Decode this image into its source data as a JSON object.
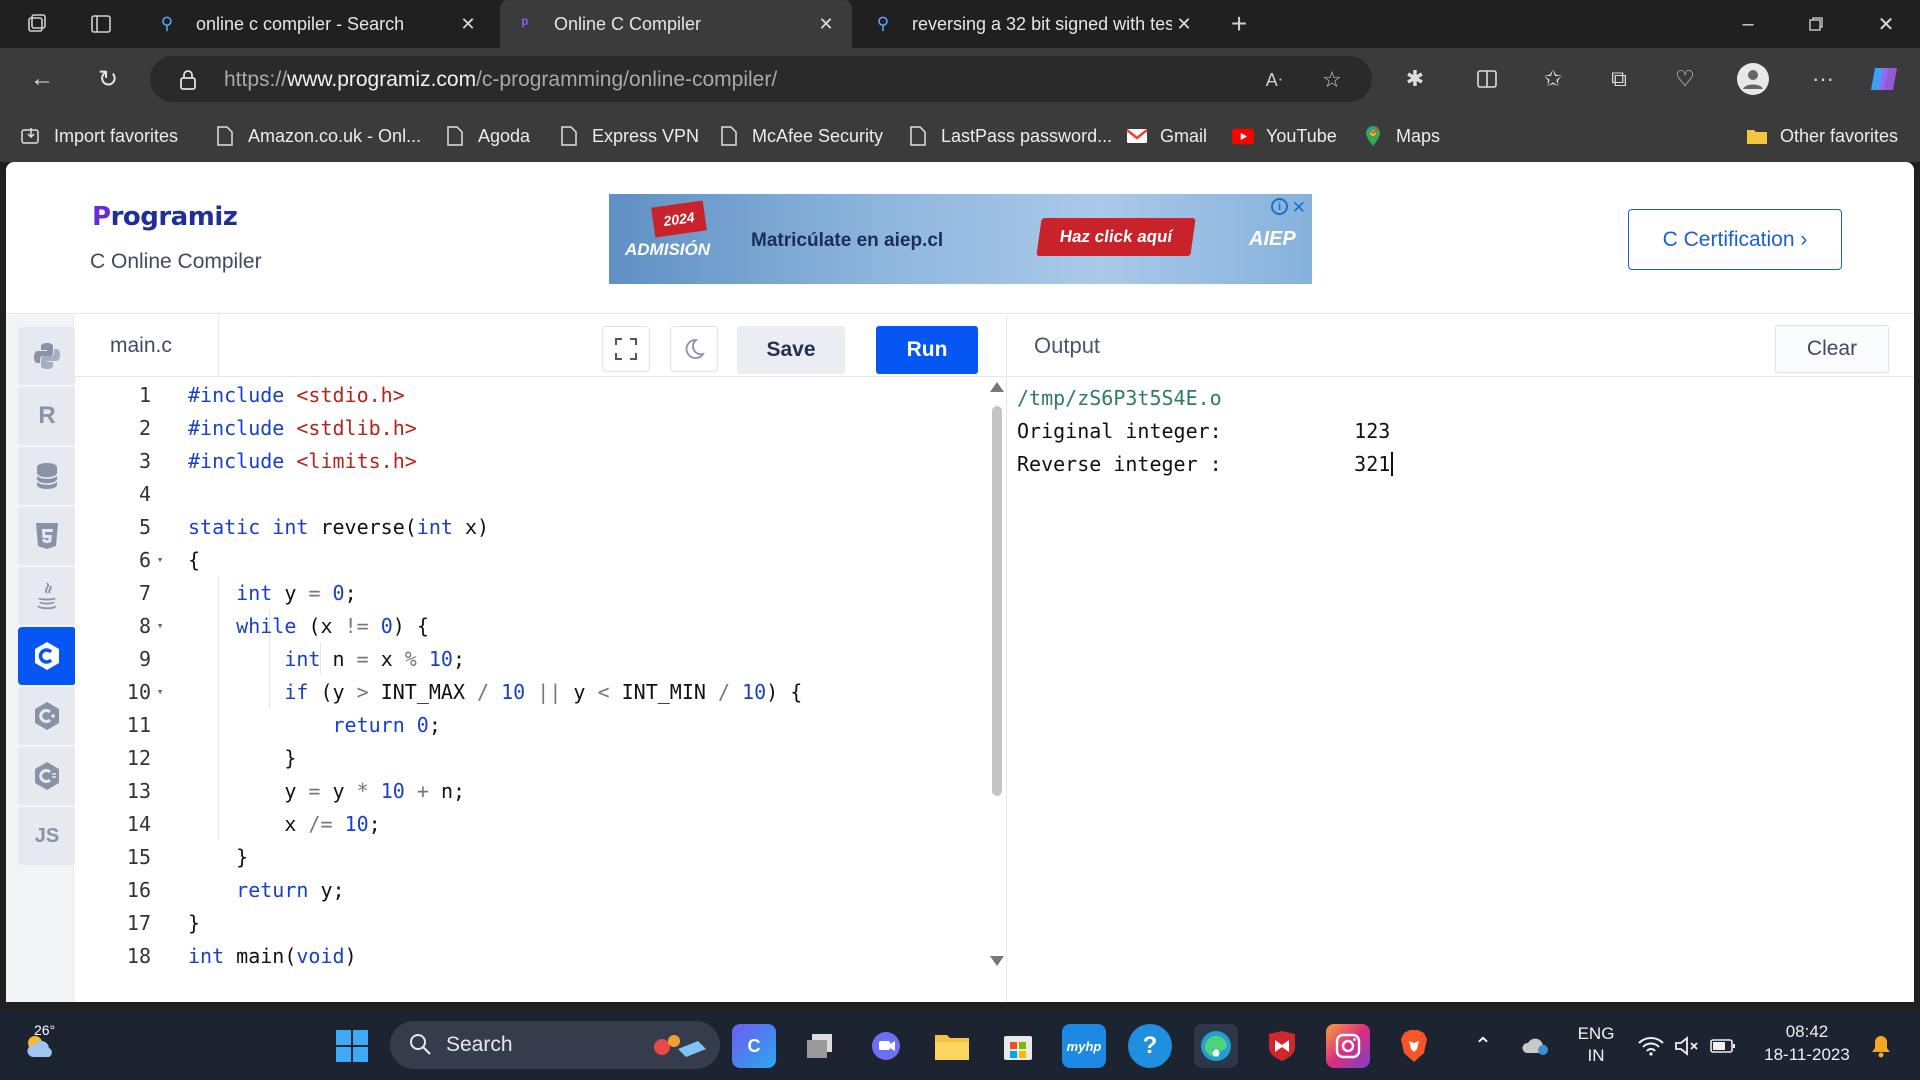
{
  "browser": {
    "tabs": [
      {
        "label": "online c compiler - Search",
        "active": false,
        "icon": "search-icon"
      },
      {
        "label": "Online C Compiler",
        "active": true,
        "icon": "programiz-icon"
      },
      {
        "label": "reversing a 32 bit signed with tes",
        "active": false,
        "icon": "search-icon"
      }
    ],
    "url_scheme": "https://",
    "url_host": "www.programiz.com",
    "url_path": "/c-programming/online-compiler/",
    "favorites": [
      {
        "label": "Import favorites",
        "icon": "import-icon"
      },
      {
        "label": "Amazon.co.uk - Onl...",
        "icon": "page-icon"
      },
      {
        "label": "Agoda",
        "icon": "page-icon"
      },
      {
        "label": "Express VPN",
        "icon": "page-icon"
      },
      {
        "label": "McAfee Security",
        "icon": "page-icon"
      },
      {
        "label": "LastPass password...",
        "icon": "page-icon"
      },
      {
        "label": "Gmail",
        "icon": "gmail-icon"
      },
      {
        "label": "YouTube",
        "icon": "youtube-icon"
      },
      {
        "label": "Maps",
        "icon": "maps-icon"
      }
    ],
    "other_favorites": "Other favorites"
  },
  "site": {
    "logo": "Programiz",
    "subtitle": "C Online Compiler",
    "ad": {
      "year": "2024",
      "admission": "ADMISIÓN",
      "message": "Matricúlate en aiep.cl",
      "cta": "Haz click aquí",
      "brand": "AIEP"
    },
    "cert_button": "C Certification ›"
  },
  "editor": {
    "filename": "main.c",
    "save_label": "Save",
    "run_label": "Run",
    "languages": [
      "python",
      "r",
      "sql",
      "html",
      "java",
      "c",
      "cpp",
      "csharp",
      "js"
    ],
    "active_language": "c",
    "js_label": "JS",
    "lines": [
      {
        "n": "1",
        "fold": ""
      },
      {
        "n": "2",
        "fold": ""
      },
      {
        "n": "3",
        "fold": ""
      },
      {
        "n": "4",
        "fold": ""
      },
      {
        "n": "5",
        "fold": ""
      },
      {
        "n": "6",
        "fold": "▾"
      },
      {
        "n": "7",
        "fold": ""
      },
      {
        "n": "8",
        "fold": "▾"
      },
      {
        "n": "9",
        "fold": ""
      },
      {
        "n": "10",
        "fold": "▾"
      },
      {
        "n": "11",
        "fold": ""
      },
      {
        "n": "12",
        "fold": ""
      },
      {
        "n": "13",
        "fold": ""
      },
      {
        "n": "14",
        "fold": ""
      },
      {
        "n": "15",
        "fold": ""
      },
      {
        "n": "16",
        "fold": ""
      },
      {
        "n": "17",
        "fold": ""
      },
      {
        "n": "18",
        "fold": ""
      }
    ],
    "code": {
      "l1": {
        "kw": "#include",
        "arg": "<stdio.h>"
      },
      "l2": {
        "kw": "#include",
        "arg": "<stdlib.h>"
      },
      "l3": {
        "kw": "#include",
        "arg": "<limits.h>"
      },
      "l5": {
        "kw1": "static",
        "kw2": "int",
        "name": "reverse(",
        "kw3": "int",
        "rest": "x)"
      },
      "l6": "{",
      "l7": {
        "kw": "int",
        "a": "y",
        "op": "=",
        "num": "0",
        "end": ";"
      },
      "l8": {
        "kw": "while",
        "a": "(x",
        "op": "!=",
        "num": "0",
        "end": ") {"
      },
      "l9": {
        "kw": "int",
        "a": "n",
        "op1": "=",
        "b": "x",
        "op2": "%",
        "num": "10",
        "end": ";"
      },
      "l10": {
        "kw": "if",
        "a": "(y",
        "op1": ">",
        "b": "INT_MAX",
        "op2": "/",
        "n1": "10",
        "op3": "||",
        "c": "y",
        "op4": "<",
        "d": "INT_MIN",
        "op5": "/",
        "n2": "10",
        "end": ") {"
      },
      "l11": {
        "kw": "return",
        "num": "0",
        "end": ";"
      },
      "l12": "}",
      "l13": {
        "a": "y",
        "op1": "=",
        "b": "y",
        "op2": "*",
        "num": "10",
        "op3": "+",
        "c": "n",
        "end": ";"
      },
      "l14": {
        "a": "x",
        "op": "/=",
        "num": "10",
        "end": ";"
      },
      "l15": "}",
      "l16": {
        "kw": "return",
        "rest": "y;"
      },
      "l17": "}",
      "l18": {
        "kw1": "int",
        "name": "main(",
        "kw2": "void",
        "end": ")"
      }
    }
  },
  "output": {
    "title": "Output",
    "clear_label": "Clear",
    "path": "/tmp/zS6P3t5S4E.o",
    "lines": [
      "Original integer:           123",
      "Reverse integer :           321"
    ]
  },
  "taskbar": {
    "weather_temp": "26°",
    "search_placeholder": "Search",
    "lang_top": "ENG",
    "lang_bottom": "IN",
    "time": "08:42",
    "date": "18-11-2023"
  }
}
